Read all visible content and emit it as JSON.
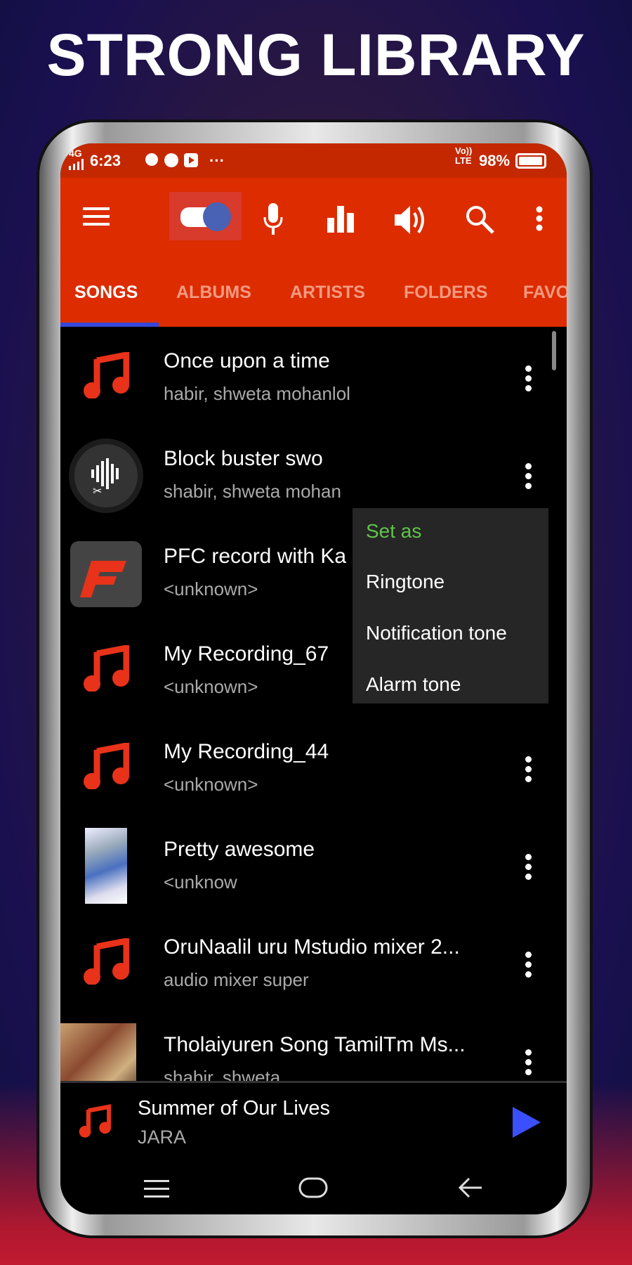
{
  "headline": "STRONG LIBRARY",
  "status": {
    "network": "4G",
    "time": "6:23",
    "more": "···",
    "volte": "Vo)) LTE",
    "battery": "98%",
    "battery_level": 98
  },
  "toolbar": {
    "icons": [
      "menu-icon",
      "toggle-icon",
      "mic-icon",
      "equalizer-icon",
      "volume-icon",
      "search-icon",
      "more-vert-icon"
    ]
  },
  "tabs": [
    {
      "label": "SONGS",
      "active": true
    },
    {
      "label": "ALBUMS"
    },
    {
      "label": "ARTISTS"
    },
    {
      "label": "FOLDERS"
    },
    {
      "label": "FAVO"
    }
  ],
  "songs": [
    {
      "title": "Once upon a time",
      "subtitle": "habir, shweta mohanlol",
      "art": "music-note"
    },
    {
      "title": "Block buster swo",
      "subtitle": "shabir, shweta mohan",
      "art": "ringtone-cutter"
    },
    {
      "title": "PFC record with Ka",
      "subtitle": "<unknown>",
      "art": "pfc-logo"
    },
    {
      "title": "My Recording_67",
      "subtitle": "<unknown>",
      "art": "music-note"
    },
    {
      "title": "My Recording_44",
      "subtitle": "<unknown>",
      "art": "music-note"
    },
    {
      "title": "Pretty awesome",
      "subtitle": "<unknow",
      "art": "winter-photo"
    },
    {
      "title": "OruNaalil uru Mstudio mixer 2...",
      "subtitle": "audio mixer super",
      "art": "music-note"
    },
    {
      "title": "Tholaiyuren Song TamilTm Ms...",
      "subtitle": "shabir, shweta",
      "art": "movie-poster"
    }
  ],
  "context_menu": {
    "header": "Set as",
    "items": [
      "Ringtone",
      "Notification tone",
      "Alarm tone"
    ]
  },
  "now_playing": {
    "title": "Summer of Our Lives",
    "artist": "JARA"
  },
  "colors": {
    "accent": "#dd2c00",
    "tab_indicator": "#3547d8",
    "note": "#e8321a",
    "menu_header": "#5fc44a",
    "play": "#3a50ff"
  }
}
